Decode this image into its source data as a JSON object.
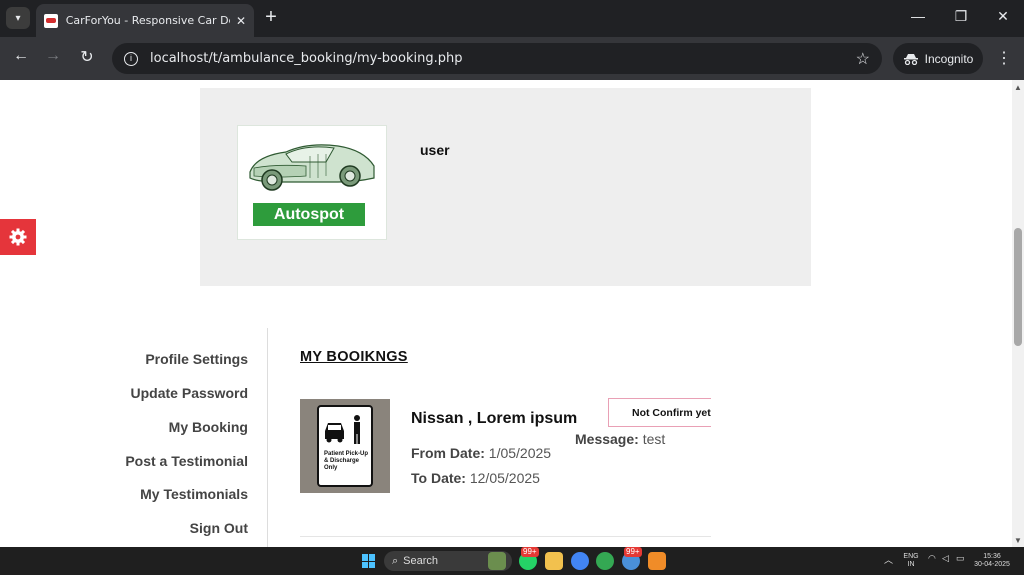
{
  "browser": {
    "tab_title": "CarForYou - Responsive Car Dealer",
    "tab_close": "✕",
    "new_tab": "+",
    "url": "localhost/t/ambulance_booking/my-booking.php",
    "incognito_label": "Incognito"
  },
  "profile": {
    "logo_text": "Autospot",
    "username": "user"
  },
  "sidebar": {
    "items": [
      {
        "label": "Profile Settings"
      },
      {
        "label": "Update Password"
      },
      {
        "label": "My Booking"
      },
      {
        "label": "Post a Testimonial"
      },
      {
        "label": "My Testimonials"
      },
      {
        "label": "Sign Out"
      }
    ]
  },
  "bookings": {
    "title": "MY BOOIKNGS",
    "items": [
      {
        "vehicle": "Nissan , Lorem ipsum",
        "from_label": "From Date:",
        "from_date": "1/05/2025",
        "to_label": "To Date:",
        "to_date": "12/05/2025",
        "status": "Not Confirm yet",
        "message_label": "Message:",
        "message": "test",
        "image_sign_text": "Patient Pick-Up & Discharge Only"
      }
    ]
  },
  "taskbar": {
    "search_label": "Search",
    "badge_1": "99+",
    "badge_2": "99+",
    "lang_line1": "ENG",
    "lang_line2": "IN",
    "time": "15:36",
    "date": "30-04-2025"
  },
  "colors": {
    "accent_red": "#e5353b",
    "logo_green": "#2e9c3c",
    "status_border": "#e9a0b5"
  }
}
